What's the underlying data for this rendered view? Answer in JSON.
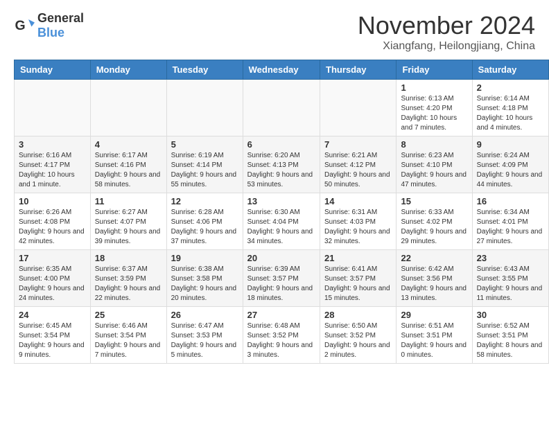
{
  "header": {
    "logo_general": "General",
    "logo_blue": "Blue",
    "month_title": "November 2024",
    "location": "Xiangfang, Heilongjiang, China"
  },
  "calendar": {
    "days_of_week": [
      "Sunday",
      "Monday",
      "Tuesday",
      "Wednesday",
      "Thursday",
      "Friday",
      "Saturday"
    ],
    "weeks": [
      {
        "shaded": false,
        "days": [
          {
            "number": "",
            "info": ""
          },
          {
            "number": "",
            "info": ""
          },
          {
            "number": "",
            "info": ""
          },
          {
            "number": "",
            "info": ""
          },
          {
            "number": "",
            "info": ""
          },
          {
            "number": "1",
            "info": "Sunrise: 6:13 AM\nSunset: 4:20 PM\nDaylight: 10 hours and 7 minutes."
          },
          {
            "number": "2",
            "info": "Sunrise: 6:14 AM\nSunset: 4:18 PM\nDaylight: 10 hours and 4 minutes."
          }
        ]
      },
      {
        "shaded": true,
        "days": [
          {
            "number": "3",
            "info": "Sunrise: 6:16 AM\nSunset: 4:17 PM\nDaylight: 10 hours and 1 minute."
          },
          {
            "number": "4",
            "info": "Sunrise: 6:17 AM\nSunset: 4:16 PM\nDaylight: 9 hours and 58 minutes."
          },
          {
            "number": "5",
            "info": "Sunrise: 6:19 AM\nSunset: 4:14 PM\nDaylight: 9 hours and 55 minutes."
          },
          {
            "number": "6",
            "info": "Sunrise: 6:20 AM\nSunset: 4:13 PM\nDaylight: 9 hours and 53 minutes."
          },
          {
            "number": "7",
            "info": "Sunrise: 6:21 AM\nSunset: 4:12 PM\nDaylight: 9 hours and 50 minutes."
          },
          {
            "number": "8",
            "info": "Sunrise: 6:23 AM\nSunset: 4:10 PM\nDaylight: 9 hours and 47 minutes."
          },
          {
            "number": "9",
            "info": "Sunrise: 6:24 AM\nSunset: 4:09 PM\nDaylight: 9 hours and 44 minutes."
          }
        ]
      },
      {
        "shaded": false,
        "days": [
          {
            "number": "10",
            "info": "Sunrise: 6:26 AM\nSunset: 4:08 PM\nDaylight: 9 hours and 42 minutes."
          },
          {
            "number": "11",
            "info": "Sunrise: 6:27 AM\nSunset: 4:07 PM\nDaylight: 9 hours and 39 minutes."
          },
          {
            "number": "12",
            "info": "Sunrise: 6:28 AM\nSunset: 4:06 PM\nDaylight: 9 hours and 37 minutes."
          },
          {
            "number": "13",
            "info": "Sunrise: 6:30 AM\nSunset: 4:04 PM\nDaylight: 9 hours and 34 minutes."
          },
          {
            "number": "14",
            "info": "Sunrise: 6:31 AM\nSunset: 4:03 PM\nDaylight: 9 hours and 32 minutes."
          },
          {
            "number": "15",
            "info": "Sunrise: 6:33 AM\nSunset: 4:02 PM\nDaylight: 9 hours and 29 minutes."
          },
          {
            "number": "16",
            "info": "Sunrise: 6:34 AM\nSunset: 4:01 PM\nDaylight: 9 hours and 27 minutes."
          }
        ]
      },
      {
        "shaded": true,
        "days": [
          {
            "number": "17",
            "info": "Sunrise: 6:35 AM\nSunset: 4:00 PM\nDaylight: 9 hours and 24 minutes."
          },
          {
            "number": "18",
            "info": "Sunrise: 6:37 AM\nSunset: 3:59 PM\nDaylight: 9 hours and 22 minutes."
          },
          {
            "number": "19",
            "info": "Sunrise: 6:38 AM\nSunset: 3:58 PM\nDaylight: 9 hours and 20 minutes."
          },
          {
            "number": "20",
            "info": "Sunrise: 6:39 AM\nSunset: 3:57 PM\nDaylight: 9 hours and 18 minutes."
          },
          {
            "number": "21",
            "info": "Sunrise: 6:41 AM\nSunset: 3:57 PM\nDaylight: 9 hours and 15 minutes."
          },
          {
            "number": "22",
            "info": "Sunrise: 6:42 AM\nSunset: 3:56 PM\nDaylight: 9 hours and 13 minutes."
          },
          {
            "number": "23",
            "info": "Sunrise: 6:43 AM\nSunset: 3:55 PM\nDaylight: 9 hours and 11 minutes."
          }
        ]
      },
      {
        "shaded": false,
        "days": [
          {
            "number": "24",
            "info": "Sunrise: 6:45 AM\nSunset: 3:54 PM\nDaylight: 9 hours and 9 minutes."
          },
          {
            "number": "25",
            "info": "Sunrise: 6:46 AM\nSunset: 3:54 PM\nDaylight: 9 hours and 7 minutes."
          },
          {
            "number": "26",
            "info": "Sunrise: 6:47 AM\nSunset: 3:53 PM\nDaylight: 9 hours and 5 minutes."
          },
          {
            "number": "27",
            "info": "Sunrise: 6:48 AM\nSunset: 3:52 PM\nDaylight: 9 hours and 3 minutes."
          },
          {
            "number": "28",
            "info": "Sunrise: 6:50 AM\nSunset: 3:52 PM\nDaylight: 9 hours and 2 minutes."
          },
          {
            "number": "29",
            "info": "Sunrise: 6:51 AM\nSunset: 3:51 PM\nDaylight: 9 hours and 0 minutes."
          },
          {
            "number": "30",
            "info": "Sunrise: 6:52 AM\nSunset: 3:51 PM\nDaylight: 8 hours and 58 minutes."
          }
        ]
      }
    ]
  }
}
